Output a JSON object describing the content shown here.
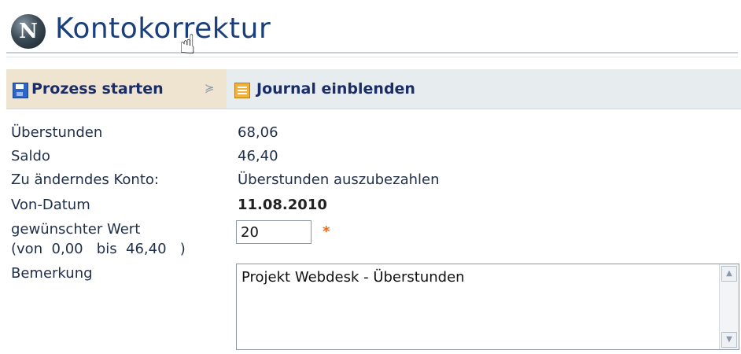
{
  "header": {
    "logo_letter": "N",
    "title": "Kontokorrektur"
  },
  "toolbar": {
    "start_label": "Prozess starten",
    "dropdown_glyph": "≽",
    "journal_label": "Journal einblenden",
    "icons": [
      "save-icon",
      "chevron-down-icon",
      "journal-icon",
      "hand-cursor-icon"
    ]
  },
  "form": {
    "overtime_label": "Überstunden",
    "overtime_value": "68,06",
    "balance_label": "Saldo",
    "balance_value": "46,40",
    "account_label": "Zu änderndes Konto:",
    "account_value": "Überstunden auszubezahlen",
    "from_date_label": "Von-Datum",
    "from_date_value": "11.08.2010",
    "desired_label_line1": "gewünschter Wert",
    "desired_label_line2": "(von  0,00   bis  46,40   )",
    "desired_value": "20",
    "required_marker": "*",
    "remark_label": "Bemerkung",
    "remark_value": "Projekt Webdesk - Überstunden"
  },
  "colors": {
    "title": "#1b3e7c",
    "toolbar_bg": "#e7ecef",
    "active_button_bg": "#efe4cf",
    "required": "#e86b1a"
  }
}
